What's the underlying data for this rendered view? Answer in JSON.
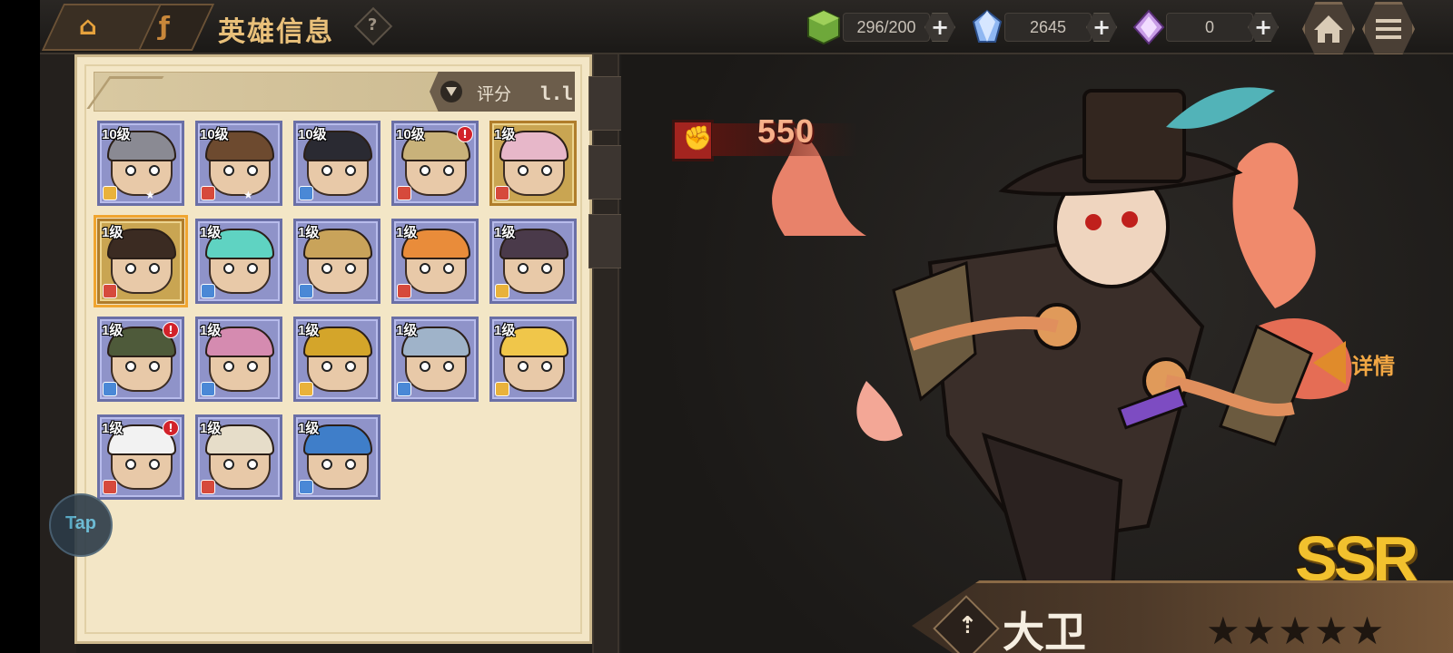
{
  "header": {
    "title": "英雄信息",
    "help": "?",
    "resources": [
      {
        "name": "stamina",
        "value": "296/200"
      },
      {
        "name": "crystal",
        "value": "2645"
      },
      {
        "name": "gem",
        "value": "0"
      }
    ],
    "plus": "+"
  },
  "list": {
    "sort_label": "评分",
    "sort_icon": "l.l",
    "heroes": [
      {
        "level": "10级",
        "cls_color": "#e9b23b",
        "hair": "#8a8a93",
        "frame": "blue",
        "alert": false
      },
      {
        "level": "10级",
        "cls_color": "#d64a3c",
        "hair": "#6d4a2f",
        "frame": "blue",
        "alert": false
      },
      {
        "level": "10级",
        "cls_color": "#4a88d6",
        "hair": "#2a2a32",
        "frame": "blue",
        "alert": false
      },
      {
        "level": "10级",
        "cls_color": "#d64a3c",
        "hair": "#c9b27a",
        "frame": "blue",
        "alert": true
      },
      {
        "level": "1级",
        "cls_color": "#d64a3c",
        "hair": "#e7b7c9",
        "frame": "gold",
        "alert": false
      },
      {
        "level": "1级",
        "cls_color": "#d64a3c",
        "hair": "#3b2b22",
        "frame": "gold",
        "alert": false,
        "selected": true
      },
      {
        "level": "1级",
        "cls_color": "#4a88d6",
        "hair": "#5fd3c2",
        "frame": "blue",
        "alert": false
      },
      {
        "level": "1级",
        "cls_color": "#4a88d6",
        "hair": "#c9a35a",
        "frame": "blue",
        "alert": false
      },
      {
        "level": "1级",
        "cls_color": "#d64a3c",
        "hair": "#e98c3a",
        "frame": "blue",
        "alert": false
      },
      {
        "level": "1级",
        "cls_color": "#e9b23b",
        "hair": "#4a3a4a",
        "frame": "blue",
        "alert": false
      },
      {
        "level": "1级",
        "cls_color": "#4a88d6",
        "hair": "#4e5a3a",
        "frame": "blue",
        "alert": true
      },
      {
        "level": "1级",
        "cls_color": "#4a88d6",
        "hair": "#d58bb0",
        "frame": "blue",
        "alert": false
      },
      {
        "level": "1级",
        "cls_color": "#e9b23b",
        "hair": "#d4a52a",
        "frame": "blue",
        "alert": false
      },
      {
        "level": "1级",
        "cls_color": "#4a88d6",
        "hair": "#9fb3c9",
        "frame": "blue",
        "alert": false
      },
      {
        "level": "1级",
        "cls_color": "#e9b23b",
        "hair": "#f0c64a",
        "frame": "blue",
        "alert": false
      },
      {
        "level": "1级",
        "cls_color": "#d64a3c",
        "hair": "#f2f2f2",
        "frame": "blue",
        "alert": true
      },
      {
        "level": "1级",
        "cls_color": "#d64a3c",
        "hair": "#e6ddc9",
        "frame": "blue",
        "alert": false
      },
      {
        "level": "1级",
        "cls_color": "#4a88d6",
        "hair": "#3f7ec9",
        "frame": "blue",
        "alert": false
      }
    ],
    "alert_mark": "!",
    "star_mark": "★"
  },
  "hero": {
    "power": "550",
    "power_icon": "fist-icon",
    "power_glyph": "✊",
    "detail_label": "详情",
    "rarity": "SSR",
    "name": "大卫",
    "class_glyph": "⇡",
    "stars": "★★★★★"
  },
  "tap": "Tap",
  "colors": {
    "accent": "#f2a744",
    "panel": "#f3e6c6",
    "rarity": "#f2c12e"
  }
}
